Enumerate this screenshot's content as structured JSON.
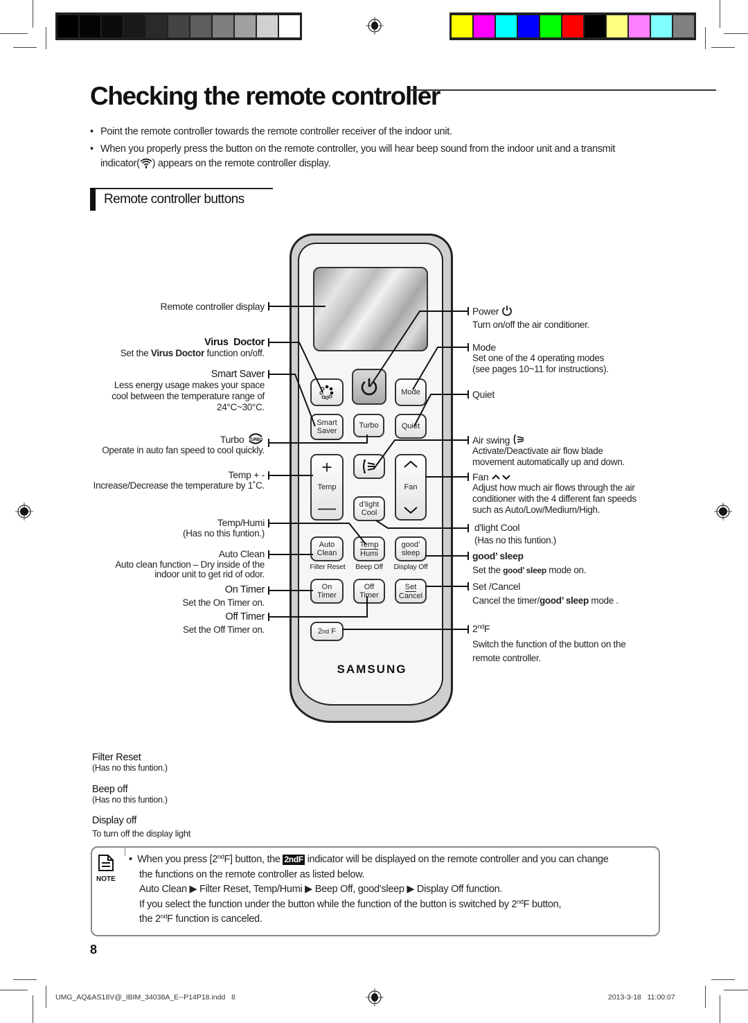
{
  "print_marks": {
    "gray_swatches": [
      "#000000",
      "#050505",
      "#0c0c0c",
      "#181818",
      "#2a2a2a",
      "#444444",
      "#5e5e5e",
      "#7e7e7e",
      "#a0a0a0",
      "#d0d0d0",
      "#ffffff"
    ],
    "color_swatches": [
      "#ffff00",
      "#ff00ff",
      "#00ffff",
      "#0000ff",
      "#00ff00",
      "#ff0000",
      "#000000",
      "#ffff80",
      "#ff80ff",
      "#80ffff",
      "#808080"
    ]
  },
  "title": "Checking the remote controller",
  "bullets": [
    "Point the remote controller towards the remote controller receiver of the indoor unit.",
    "When you properly press the button on the remote controller, you will hear beep sound from the indoor unit and a transmit"
  ],
  "bullet2_line2_pre": "indicator(",
  "bullet2_line2_post": ") appears on the remote controller display.",
  "section_title": "Remote controller buttons",
  "remote": {
    "buttons": {
      "virus_doctor": "",
      "mode": "Mode",
      "smart_saver_1": "Smart",
      "smart_saver_2": "Saver",
      "turbo": "Turbo",
      "quiet": "Quiet",
      "temp": "Temp",
      "fan": "Fan",
      "dlight_1": "d’light",
      "dlight_2": "Cool",
      "auto_clean_1": "Auto",
      "auto_clean_2": "Clean",
      "temp_humi_1": "Temp",
      "temp_humi_2": "Humi",
      "good_sleep_1": "good’",
      "good_sleep_2": "sleep",
      "on_timer_1": "On",
      "on_timer_2": "Timer",
      "off_timer_1": "Off",
      "off_timer_2": "Timer",
      "set_cancel_1": "Set",
      "set_cancel_2": "Cancel",
      "second_f": "2",
      "second_f_sup": "nd",
      "second_f_suffix": " F"
    },
    "under_labels": {
      "filter_reset": "Filter Reset",
      "beep_off": "Beep Off",
      "display_off": "Display Off"
    },
    "brand": "SAMSUNG"
  },
  "left_labels": {
    "display": "Remote controller display",
    "virus_doctor": "Virus  Doctor",
    "virus_doctor_desc_pre": "Set the ",
    "virus_doctor_desc_bold": "Virus Doctor",
    "virus_doctor_desc_post": " function on/off.",
    "smart_saver": "Smart Saver",
    "smart_saver_desc_1": "Less energy usage makes your space",
    "smart_saver_desc_2": "cool between the temperature range of",
    "smart_saver_desc_3": "24°C~30°C.",
    "turbo": "Turbo",
    "turbo_desc": "Operate in auto fan speed to cool quickly.",
    "temp": "Temp + -",
    "temp_desc": "Increase/Decrease the temperature by 1˚C.",
    "temp_humi": "Temp/Humi",
    "temp_humi_desc": "(Has no this funtion.)",
    "auto_clean": "Auto Clean",
    "auto_clean_desc_1": "Auto clean function – Dry inside of the",
    "auto_clean_desc_2": "indoor unit to get rid of odor.",
    "on_timer": "On Timer",
    "on_timer_desc": "Set the On Timer on.",
    "off_timer": "Off Timer",
    "off_timer_desc": "Set the Off Timer on."
  },
  "right_labels": {
    "power": "Power",
    "power_desc": "Turn on/off the air conditioner.",
    "mode": "Mode",
    "mode_desc_1": "Set one of the 4 operating modes",
    "mode_desc_2": "(see pages 10~11 for instructions).",
    "quiet": "Quiet",
    "air_swing": "Air swing",
    "air_swing_desc_1": "Activate/Deactivate air flow blade",
    "air_swing_desc_2": "movement automatically up and down.",
    "fan": "Fan",
    "fan_desc_1": "Adjust how much air flows through the air",
    "fan_desc_2": "conditioner with the 4 different fan speeds",
    "fan_desc_3": "such as Auto/Low/Medium/High.",
    "dlight": "d'light Cool",
    "dlight_desc": "(Has no this funtion.)",
    "good_sleep": "good’ sleep",
    "good_sleep_desc_pre": "Set the ",
    "good_sleep_desc_bold": "good’ sleep",
    "good_sleep_desc_post": " mode on.",
    "set_cancel": "Set /Cancel",
    "set_cancel_desc_pre": "Cancel the timer/",
    "set_cancel_desc_bold": "good’ sleep",
    "set_cancel_desc_post": " mode .",
    "second_f": "2",
    "second_f_sup": "nd",
    "second_f_suffix": "F",
    "second_f_desc_1": "Switch the function of the button on the",
    "second_f_desc_2": "remote controller."
  },
  "bottom_labels": [
    {
      "name": "Filter Reset",
      "desc": "(Has no this funtion.)"
    },
    {
      "name": "Beep off",
      "desc": "(Has no this funtion.)"
    },
    {
      "name": "Display off",
      "desc": "To turn off the display light"
    }
  ],
  "note": {
    "icon_label": "NOTE",
    "l1_pre": "When you press [2",
    "sup": "nd",
    "l1_mid": "F] button, the ",
    "indicator": "2ndF",
    "l1_post": " indicator will be displayed on the remote controller and  you can change",
    "l2": "the functions on the remote controller as listed below.",
    "l3": "Auto Clean ▶ Filter Reset, Temp/Humi ▶ Beep Off, good’sleep ▶ Display Off function.",
    "l4_pre": "If you select the function under the button while the function of the button is switched by 2",
    "l4_post": "F button,",
    "l5_pre": "the 2",
    "l5_post": "F function is canceled."
  },
  "page_number": "8",
  "slug_file": "UMG_AQ&AS18V@_IBIM_34038A_E--P14P18.indd   8",
  "slug_date": "2013-3-18   11:00:07"
}
